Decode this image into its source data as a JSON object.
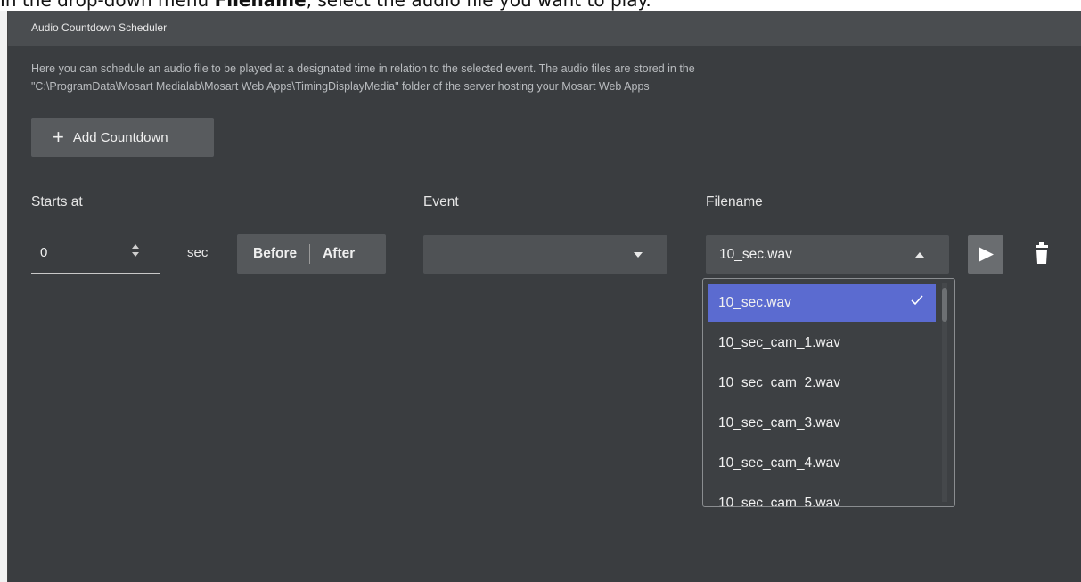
{
  "caption": {
    "prefix": "In the drop-down menu ",
    "bold": "Filename",
    "suffix": ", select the audio file you want to play."
  },
  "panel": {
    "title": "Audio Countdown Scheduler",
    "description_line1": "Here you can schedule an audio file to be played at a designated time in relation to the selected event. The audio files are stored in the",
    "description_line2": "\"C:\\ProgramData\\Mosart Medialab\\Mosart Web Apps\\TimingDisplayMedia\" folder of the server hosting your Mosart Web Apps",
    "add_button_label": "Add Countdown"
  },
  "columns": {
    "starts_at": "Starts at",
    "event": "Event",
    "filename": "Filename"
  },
  "row": {
    "starts_value": "0",
    "unit": "sec",
    "before_label": "Before",
    "after_label": "After",
    "event_value": "",
    "filename_value": "10_sec.wav"
  },
  "dropdown": {
    "options": [
      "10_sec.wav",
      "10_sec_cam_1.wav",
      "10_sec_cam_2.wav",
      "10_sec_cam_3.wav",
      "10_sec_cam_4.wav",
      "10_sec_cam_5.wav"
    ],
    "selected_index": 0
  },
  "icons": {
    "plus": "plus-icon",
    "spinner": "spinner-arrows-icon",
    "caret_down": "chevron-down-icon",
    "caret_up": "chevron-up-icon",
    "play": "play-icon",
    "trash": "trash-icon",
    "check": "check-icon"
  },
  "colors": {
    "panel_bg": "#3a3d40",
    "header_bg": "#4a4d50",
    "accent_selected": "#5b6bd0"
  }
}
